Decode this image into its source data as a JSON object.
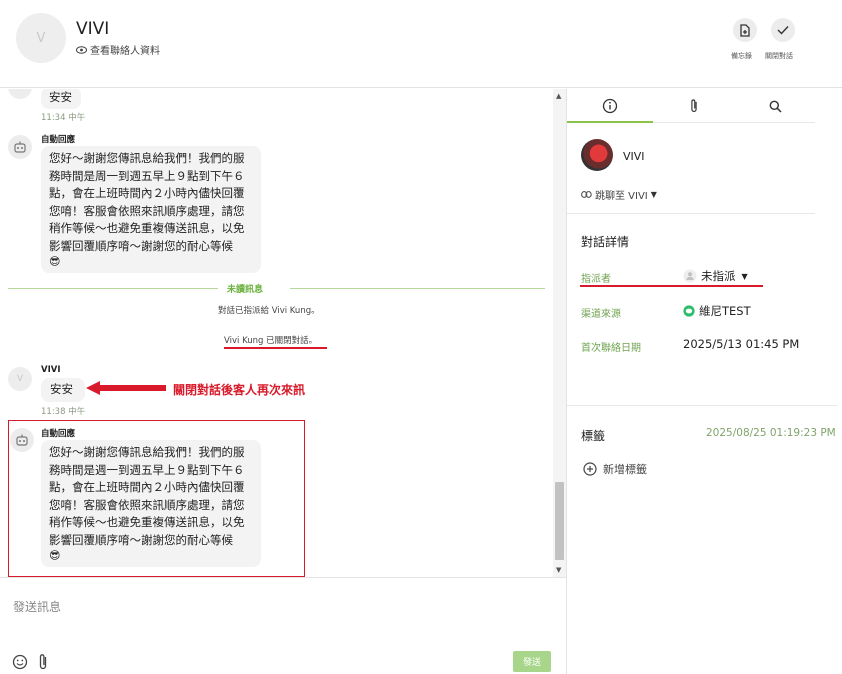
{
  "header": {
    "avatar_letter": "V",
    "contact_name": "VIVI",
    "view_profile_label": "查看聯絡人資料",
    "memo_label": "備忘錄",
    "close_conversation_label": "關閉對話"
  },
  "chat": {
    "messages": [
      {
        "text": "安安",
        "time": "11:34 中午"
      },
      {
        "sender": "自動回應",
        "lines": [
          "您好～謝謝您傳訊息給我們！我們的服",
          "務時間是周一到週五早上９點到下午６",
          "點，會在上班時間內２小時內儘快回覆",
          "您唷！客服會依照來訊順序處理，請您",
          "稍作等候～也避免重複傳送訊息，以免",
          "影響回覆順序唷～謝謝您的耐心等候"
        ],
        "emoji": "😎"
      },
      {
        "unread_label": "未讀訊息"
      },
      {
        "system": "對話已指派給 Vivi Kung。"
      },
      {
        "system": "Vivi Kung 已關閉對話。"
      },
      {
        "sender": "VIVI",
        "avatar_letter": "V",
        "text": "安安",
        "time": "11:38 中午"
      },
      {
        "sender": "自動回應",
        "lines": [
          "您好～謝謝您傳訊息給我們！我們的服",
          "務時間是週一到週五早上９點到下午６",
          "點，會在上班時間內２小時內儘快回覆",
          "您唷！客服會依照來訊順序處理，請您",
          "稍作等候～也避免重複傳送訊息，以免",
          "影響回覆順序唷～謝謝您的耐心等候"
        ],
        "emoji": "😎"
      }
    ],
    "annotation": "關閉對話後客人再次來訊"
  },
  "composer": {
    "placeholder": "發送訊息",
    "send_label": "發送"
  },
  "right_panel": {
    "contact_name": "VIVI",
    "jump_label": "跳聊至 VIVI",
    "details_title": "對話詳情",
    "assignee_label": "指派者",
    "assignee_value": "未指派",
    "channel_label": "渠道來源",
    "channel_value": "維尼TEST",
    "first_contact_label": "首次聯絡日期",
    "first_contact_value": "2025/5/13 01:45 PM",
    "tags_title": "標籤",
    "tags_date": "2025/08/25 01:19:23 PM",
    "add_tag_label": "新增標籤"
  },
  "colors": {
    "accent_green": "#8bc34a",
    "annotation_red": "#d91a2a",
    "channel_icon": "#2ebd6b"
  }
}
